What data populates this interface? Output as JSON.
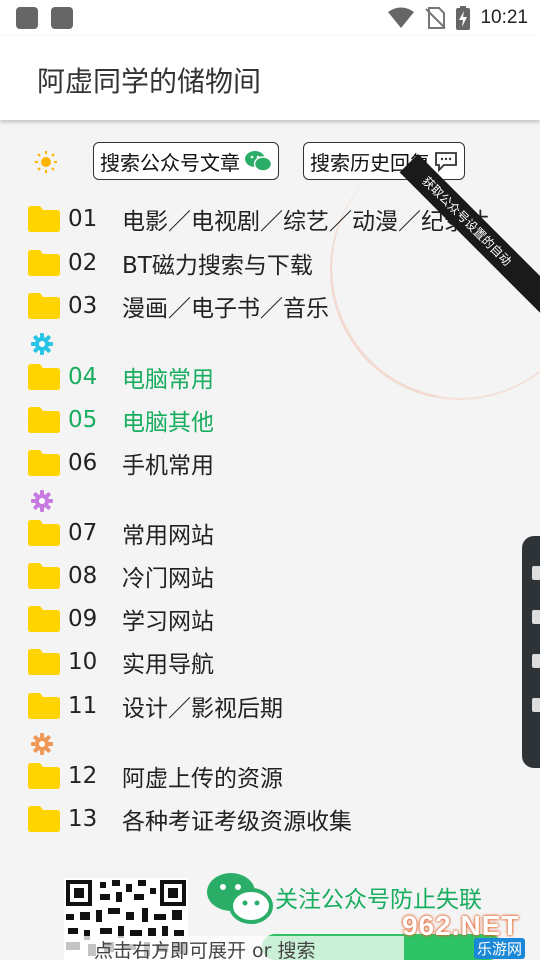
{
  "status_bar": {
    "time": "10:21"
  },
  "app_bar": {
    "title": "阿虚同学的储物间"
  },
  "toolbar": {
    "search_articles_label": "搜索公众号文章",
    "search_history_label": "搜索历史回复",
    "ribbon_text": "获取公众号设置的自动"
  },
  "folders": [
    {
      "num": "01",
      "label": "电影／电视剧／综艺／动漫／纪录片"
    },
    {
      "num": "02",
      "label": "BT磁力搜索与下载"
    },
    {
      "num": "03",
      "label": "漫画／电子书／音乐"
    },
    {
      "num": "04",
      "label": "电脑常用"
    },
    {
      "num": "05",
      "label": "电脑其他"
    },
    {
      "num": "06",
      "label": "手机常用"
    },
    {
      "num": "07",
      "label": "常用网站"
    },
    {
      "num": "08",
      "label": "冷门网站"
    },
    {
      "num": "09",
      "label": "学习网站"
    },
    {
      "num": "10",
      "label": "实用导航"
    },
    {
      "num": "11",
      "label": "设计／影视后期"
    },
    {
      "num": "12",
      "label": "阿虚上传的资源"
    },
    {
      "num": "13",
      "label": "各种考证考级资源收集"
    }
  ],
  "footer": {
    "follow_text": "关注公众号防止失联",
    "hint_text": "点击右方即可展开 or 搜索"
  },
  "watermark": {
    "top": "962.NET",
    "bottom": "乐游网"
  },
  "colors": {
    "green": "#19ad5f",
    "folder": "#ffd400",
    "gear_cyan": "#29c4e6",
    "gear_purple": "#c77be0",
    "gear_orange": "#f09a5a"
  }
}
